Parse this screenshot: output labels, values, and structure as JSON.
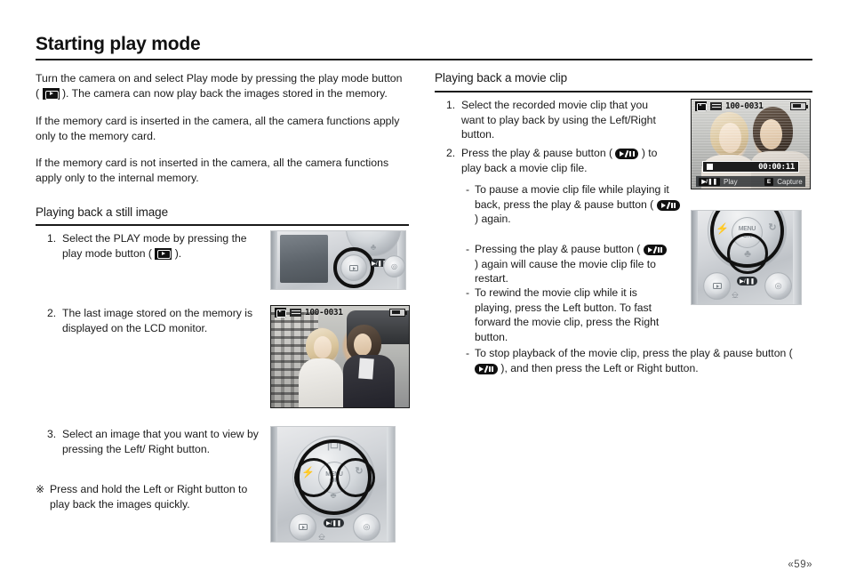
{
  "page": {
    "title": "Starting play mode",
    "folio": "«59»"
  },
  "left_column": {
    "intro_paragraphs": [
      {
        "part1": "Turn the camera on and select Play mode by pressing the play mode button",
        "icon": "play-mode-icon",
        "part2": "). The camera can now play back the images stored in the memory.",
        "open_paren": "("
      },
      {
        "text": "If the memory card is inserted in the camera, all the camera functions apply only to the memory card."
      },
      {
        "text": "If the memory card is not inserted in the camera, all the camera functions apply only to the internal memory."
      }
    ],
    "section_heading": "Playing back a still image",
    "steps": [
      {
        "num": "1.",
        "text_before": "Select the PLAY mode by pressing the play mode button (",
        "icon": "play-mode-icon",
        "text_after": ")."
      },
      {
        "num": "2.",
        "text": "The last image stored on the memory is displayed on the LCD monitor."
      },
      {
        "num": "3.",
        "text": "Select an image that you want to view by pressing the Left/ Right button."
      },
      {
        "num": "※",
        "text": "Press and hold the Left or Right button to play back the images quickly."
      }
    ],
    "figures": {
      "play_button_camera": {
        "name": "camera-back-play-button-diagram"
      },
      "still_image_lcd": {
        "name": "lcd-still-image",
        "osd": {
          "mode_icon": "play-mode-icon",
          "card_icon": "memory-card-icon",
          "filename": "100-0031",
          "battery_icon": "battery-icon"
        }
      },
      "nav_pad_camera": {
        "name": "camera-navigation-pad-diagram",
        "labels": {
          "up": "display",
          "left": "flash",
          "right": "self-timer",
          "down": "macro",
          "center_line1": "MENU",
          "center_line2": "OK",
          "play_pause": "▶/❚❚"
        }
      }
    }
  },
  "right_column": {
    "section_heading": "Playing back a movie clip",
    "steps": [
      {
        "num": "1.",
        "text": "Select the recorded movie clip that you want to play back by using the Left/Right button."
      },
      {
        "num": "2.",
        "text_before": "Press the play & pause button (",
        "icon": "play-pause-icon",
        "text_after": ") to play back a movie clip file."
      }
    ],
    "bullets": [
      {
        "dash": "-",
        "text_before": "To pause a movie clip file while playing it back, press the play & pause button (",
        "icon": "play-pause-icon",
        "text_after": ") again."
      },
      {
        "dash": "-",
        "text_before": "Pressing the play & pause button (",
        "icon": "play-pause-icon",
        "text_after": ") again will cause the movie clip file to restart."
      },
      {
        "dash": "-",
        "text": "To rewind the movie clip while it is playing, press the Left button. To fast forward the movie clip, press the Right button."
      },
      {
        "dash": "-",
        "text_before": "To stop playback of the movie clip, press the play & pause button (",
        "icon": "play-pause-icon",
        "text_after": "), and then press the Left  or Right button."
      }
    ],
    "figures": {
      "movie_lcd": {
        "name": "lcd-movie-clip",
        "osd": {
          "mode_icon": "play-mode-icon",
          "card_icon": "memory-card-icon",
          "filename": "100-0031",
          "battery_icon": "battery-icon",
          "timecode": "00:00:11",
          "key_play_label": "Play",
          "key_capture_chip": "E",
          "key_capture_label": "Capture"
        }
      },
      "play_pause_camera": {
        "name": "camera-play-pause-button-diagram",
        "labels": {
          "left": "flash",
          "right": "self-timer",
          "down": "macro",
          "center_line1": "MENU",
          "center_line2": "OK",
          "play_pause": "▶/❚❚"
        }
      }
    }
  },
  "colors": {
    "text": "#1a1a1a",
    "rule": "#1a1a1a",
    "lcd_border": "#1a1a1a",
    "osd_dark": "#111111"
  }
}
